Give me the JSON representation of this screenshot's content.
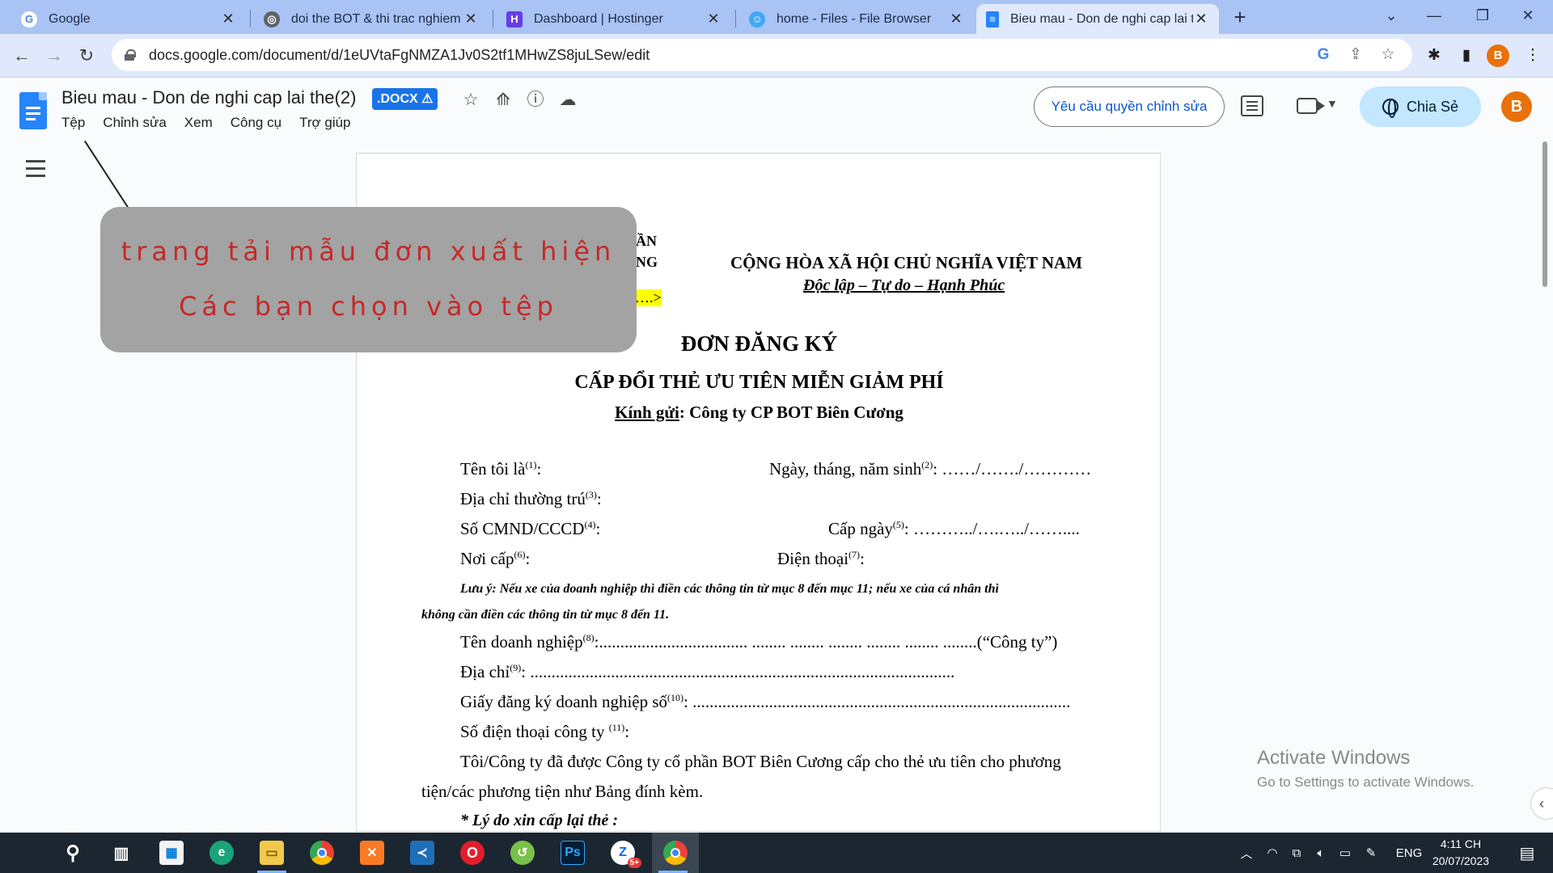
{
  "browser": {
    "tabs": [
      {
        "title": "Google",
        "favicon": "google-icon",
        "color": "#4285f4"
      },
      {
        "title": "doi the BOT & thi trac nghiem bo",
        "favicon": "globe-icon",
        "color": "#5f6368"
      },
      {
        "title": "Dashboard | Hostinger",
        "favicon": "hostinger-icon",
        "color": "#673de6"
      },
      {
        "title": "home - Files - File Browser",
        "favicon": "filebrowser-icon",
        "color": "#40a8f5"
      },
      {
        "title": "Bieu mau - Don de nghi cap lai th",
        "favicon": "docs-icon",
        "color": "#2684fc"
      }
    ],
    "url": "docs.google.com/document/d/1eUVtaFgNMZA1Jv0S2tf1MHwZS8juLSew/edit",
    "profile_initial": "B"
  },
  "docs": {
    "title": "Bieu mau - Don de nghi cap lai the(2)",
    "badge": ".DOCX ⚠",
    "menu": [
      "Tệp",
      "Chỉnh sửa",
      "Xem",
      "Công cụ",
      "Trợ giúp"
    ],
    "request_edit": "Yêu cầu quyền chỉnh sửa",
    "share": "Chia Sẻ",
    "account_initial": "B",
    "brand_color": "#2684fc"
  },
  "page": {
    "org_line1": "ẦN",
    "org_line2": "NG",
    "highlight": "….>",
    "republic": "CỘNG HÒA XÃ HỘI CHỦ NGHĨA VIỆT NAM",
    "motto": "Độc lập – Tự do – Hạnh Phúc",
    "heading1": "ĐƠN ĐĂNG KÝ",
    "heading2": "CẤP ĐỔI THẺ ƯU TIÊN MIỄN GIẢM PHÍ",
    "kinh_gui_label": "Kính gửi",
    "kinh_gui_rest": ": Công ty CP BOT Biên Cương",
    "name_label": "Tên tôi là",
    "name_sup": "(1)",
    "dob_label": "Ngày, tháng, năm sinh",
    "dob_sup": "(2)",
    "dob_value": ": ……/……./…………",
    "address_label": "Địa chỉ thường trú",
    "address_sup": "(3)",
    "id_label": "Số CMND/CCCD",
    "id_sup": "(4)",
    "issue_date_label": "Cấp ngày",
    "issue_date_sup": "(5)",
    "issue_date_value": ": ………../….…../……....",
    "issue_place_label": "Nơi cấp",
    "issue_place_sup": "(6)",
    "phone_label": "Điện thoại",
    "phone_sup": "(7)",
    "note_line1": "Lưu ý: Nếu xe của doanh nghiệp thì điền các thông tin từ mục 8 đến mục 11; nếu xe của cá nhân thì",
    "note_line2": "không cần điền các thông tin từ mục 8 đến 11.",
    "company_label": "Tên doanh nghiệp",
    "company_sup": "(8)",
    "company_value": ":................................... ........ ........ ........ ........ ........ ........(“Công ty”)",
    "company_address_label": "Địa chỉ",
    "company_address_sup": "(9)",
    "company_address_value": ": ....................................................................................................",
    "business_reg_label": "Giấy đăng ký doanh nghiệp số",
    "business_reg_sup": "(10)",
    "business_reg_value": ": .........................................................................................",
    "company_phone_label": "Số điện thoại công ty ",
    "company_phone_sup": "(11)",
    "body_line1": "Tôi/Công ty đã được Công ty cổ phần BOT Biên Cương cấp cho thẻ ưu tiên cho phương",
    "body_line2": "tiện/các phương tiện như Bảng đính kèm.",
    "reason": "* Lý do xin cấp lại thẻ :"
  },
  "annotation": {
    "line1": "trang tải mẫu đơn xuất hiện",
    "line2": "Các bạn chọn vào tệp",
    "text_color": "#c62828"
  },
  "activate_windows": {
    "title": "Activate Windows",
    "subtitle": "Go to Settings to activate Windows."
  },
  "taskbar": {
    "apps": [
      "start",
      "search",
      "task-view",
      "store",
      "edge",
      "file-explorer",
      "chrome",
      "xampp",
      "vscode",
      "opera",
      "sourcetree",
      "photoshop",
      "zalo",
      "chrome-profile"
    ],
    "zalo_badge": "5+",
    "language": "ENG",
    "time": "4:11 CH",
    "date": "20/07/2023"
  }
}
